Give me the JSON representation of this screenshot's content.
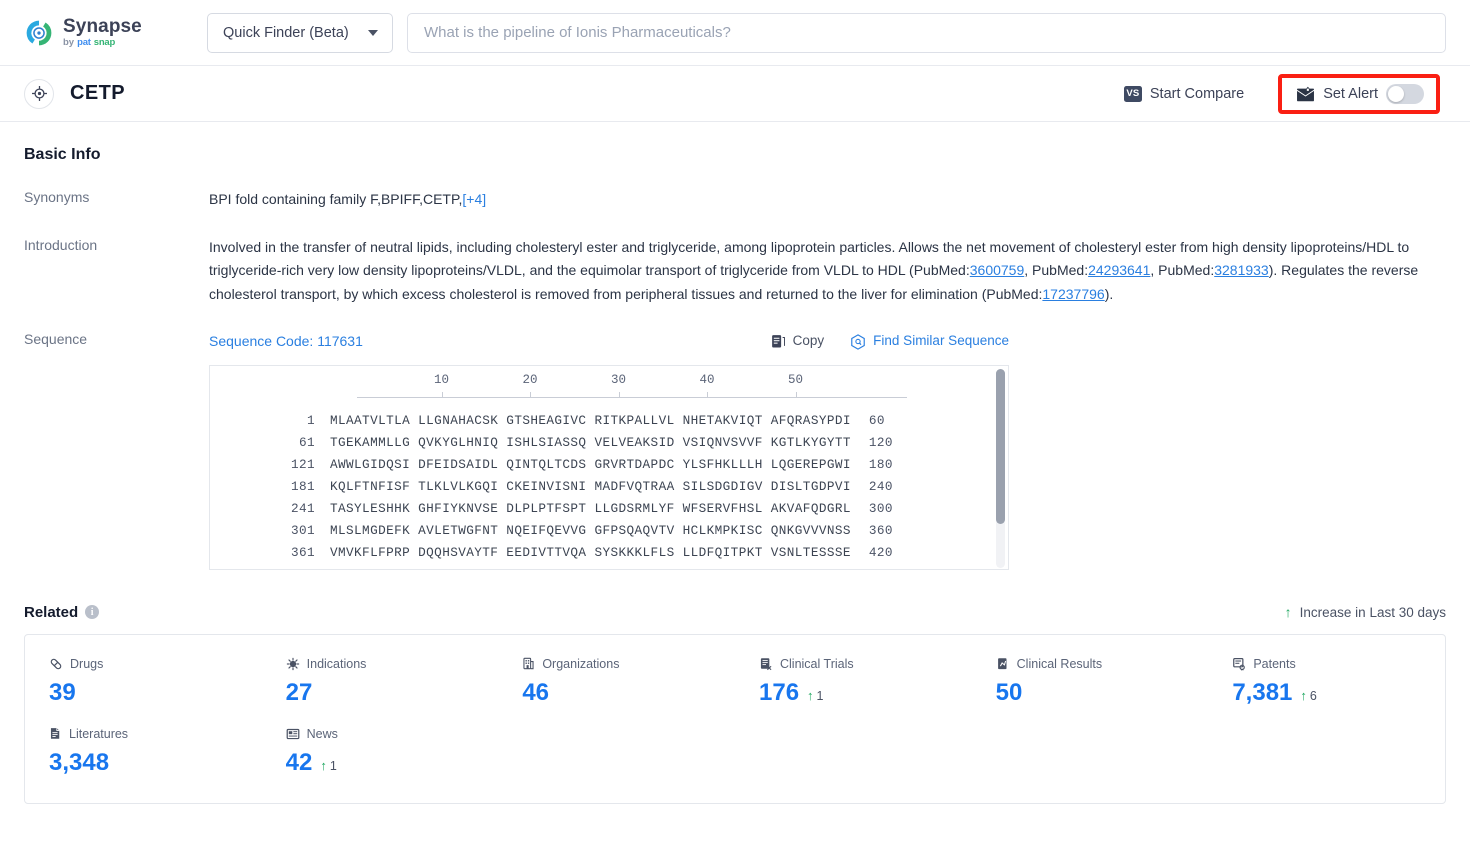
{
  "header": {
    "brand": {
      "title": "Synapse",
      "by": "by",
      "pat": "pat",
      "snap": "snap"
    },
    "finder": {
      "label": "Quick Finder (Beta)",
      "icon": "chevron-down-icon"
    },
    "search": {
      "value": "",
      "placeholder": "What is the pipeline of Ionis Pharmaceuticals?"
    }
  },
  "entity": {
    "icon": "target-icon",
    "name": "CETP",
    "start_compare": {
      "label": "Start Compare",
      "badge": "VS"
    },
    "set_alert": {
      "label": "Set Alert",
      "toggle_state": "off",
      "highlighted": true,
      "highlight_color": "#fa1f13"
    }
  },
  "basic_info": {
    "title": "Basic Info",
    "synonyms": {
      "label": "Synonyms",
      "value": "BPI fold containing family F,BPIFF,CETP,",
      "more": "[+4]"
    },
    "introduction": {
      "label": "Introduction",
      "parts": [
        {
          "type": "text",
          "text": "Involved in the transfer of neutral lipids, including cholesteryl ester and triglyceride, among lipoprotein particles. Allows the net movement of cholesteryl ester from high density lipoproteins/HDL to triglyceride-rich very low density lipoproteins/VLDL, and the equimolar transport of triglyceride from VLDL to HDL (PubMed:"
        },
        {
          "type": "link",
          "text": "3600759"
        },
        {
          "type": "text",
          "text": ", PubMed:"
        },
        {
          "type": "link",
          "text": "24293641"
        },
        {
          "type": "text",
          "text": ", PubMed:"
        },
        {
          "type": "link",
          "text": "3281933"
        },
        {
          "type": "text",
          "text": "). Regulates the reverse cholesterol transport, by which excess cholesterol is removed from peripheral tissues and returned to the liver for elimination (PubMed:"
        },
        {
          "type": "link",
          "text": "17237796"
        },
        {
          "type": "text",
          "text": ")."
        }
      ]
    },
    "sequence": {
      "label": "Sequence",
      "code_label": "Sequence Code: 117631",
      "copy_label": "Copy",
      "copy_icon": "copy-icon",
      "similar_label": "Find Similar Sequence",
      "similar_icon": "hexagon-search-icon",
      "ruler_ticks": [
        "10",
        "20",
        "30",
        "40",
        "50"
      ],
      "lines": [
        {
          "start": "1",
          "chunks": "MLAATVLTLA LLGNAHACSK GTSHEAGIVC RITKPALLVL NHETAKVIQT AFQRASYPDI",
          "end": "60"
        },
        {
          "start": "61",
          "chunks": "TGEKAMMLLG QVKYGLHNIQ ISHLSIASSQ VELVEAKSID VSIQNVSVVF KGTLKYGYTT",
          "end": "120"
        },
        {
          "start": "121",
          "chunks": "AWWLGIDQSI DFEIDSAIDL QINTQLTCDS GRVRTDAPDC YLSFHKLLLH LQGEREPGWI",
          "end": "180"
        },
        {
          "start": "181",
          "chunks": "KQLFTNFISF TLKLVLKGQI CKEINVISNI MADFVQTRAA SILSDGDIGV DISLTGDPVI",
          "end": "240"
        },
        {
          "start": "241",
          "chunks": "TASYLESHHK GHFIYKNVSE DLPLPTFSPT LLGDSRMLYF WFSERVFHSL AKVAFQDGRL",
          "end": "300"
        },
        {
          "start": "301",
          "chunks": "MLSLMGDEFK AVLETWGFNT NQEIFQEVVG GFPSQAQVTV HCLKMPKISC QNKGVVVNSS",
          "end": "360"
        },
        {
          "start": "361",
          "chunks": "VMVKFLFPRP DQQHSVAYTF EEDIVTTVQA SYSKKKLFLS LLDFQITPKT VSNLTESSSE",
          "end": "420"
        }
      ]
    }
  },
  "related": {
    "title": "Related",
    "info_icon": "info-icon",
    "increase_note": "Increase in Last 30 days",
    "increase_arrow": "arrow-up-icon",
    "accent_color": "#1876ee",
    "increase_color": "#21a862",
    "items": [
      {
        "label": "Drugs",
        "icon": "pill-icon",
        "value": "39",
        "delta": ""
      },
      {
        "label": "Indications",
        "icon": "virus-icon",
        "value": "27",
        "delta": ""
      },
      {
        "label": "Organizations",
        "icon": "building-icon",
        "value": "46",
        "delta": ""
      },
      {
        "label": "Clinical Trials",
        "icon": "clinical-trial-icon",
        "value": "176",
        "delta": "1"
      },
      {
        "label": "Clinical Results",
        "icon": "clinical-result-icon",
        "value": "50",
        "delta": ""
      },
      {
        "label": "Patents",
        "icon": "patent-icon",
        "value": "7,381",
        "delta": "6"
      },
      {
        "label": "Literatures",
        "icon": "literature-icon",
        "value": "3,348",
        "delta": ""
      },
      {
        "label": "News",
        "icon": "news-icon",
        "value": "42",
        "delta": "1"
      }
    ]
  }
}
